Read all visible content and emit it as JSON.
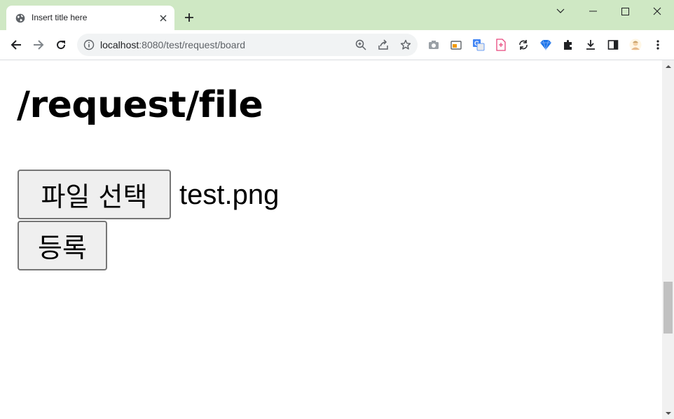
{
  "tab": {
    "title": "Insert title here"
  },
  "address": {
    "host": "localhost",
    "path": ":8080/test/request/board"
  },
  "page": {
    "heading": "/request/file",
    "file_button_label": "파일 선택",
    "file_name": "test.png",
    "submit_label": "등록"
  },
  "icons": {
    "tab": [
      "globe-icon",
      "close-icon",
      "plus-icon"
    ],
    "window": [
      "chevron-down-icon",
      "minimize-icon",
      "maximize-icon",
      "close-icon"
    ],
    "nav": [
      "back-icon",
      "forward-icon",
      "reload-icon"
    ],
    "omnibox": [
      "info-icon",
      "zoom-icon",
      "share-icon",
      "star-icon"
    ],
    "extensions": [
      "camera-icon",
      "screen-capture-icon",
      "translate-icon",
      "pdf-icon",
      "sync-icon",
      "diamond-icon",
      "puzzle-icon",
      "download-icon",
      "sidepanel-icon",
      "avatar-icon",
      "kebab-menu-icon"
    ]
  },
  "colors": {
    "tabstrip": "#cfe8c4",
    "button_bg": "#efefef",
    "button_border": "#767676",
    "translate": "#4285f4",
    "pdf": "#e8467c",
    "diamond": "#1a73e8"
  }
}
